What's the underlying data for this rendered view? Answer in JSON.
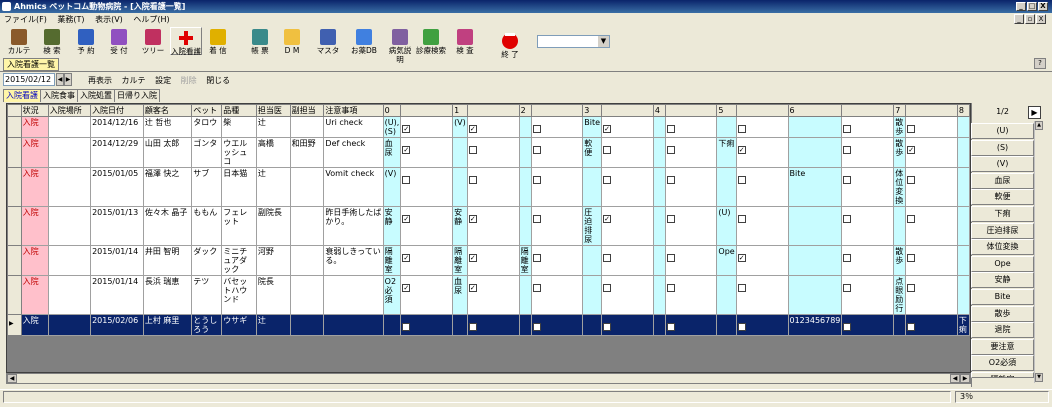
{
  "window": {
    "title": "Ahmics ペットコム動物病院 - [入院看護一覧]",
    "min": "_",
    "max": "□",
    "close": "X",
    "mdi_min": "_",
    "mdi_restore": "▫",
    "mdi_close": "X"
  },
  "menu": [
    "ファイル(F)",
    "業務(T)",
    "表示(V)",
    "ヘルプ(H)"
  ],
  "toolbar": [
    {
      "label": "カルテ",
      "icon": "paw-icon",
      "color": "#8a5a2b"
    },
    {
      "label": "検 索",
      "icon": "binoculars-icon",
      "color": "#556b2f"
    },
    {
      "label": "予 約",
      "icon": "calendar-icon",
      "color": "#3060c0"
    },
    {
      "label": "受 付",
      "icon": "reception-icon",
      "color": "#9050c0"
    },
    {
      "label": "ツリー",
      "icon": "tree-icon",
      "color": "#c03060"
    },
    {
      "label": "入院看護",
      "icon": "red-cross-icon",
      "color": "#e00000"
    },
    {
      "label": "着 信",
      "icon": "phone-icon",
      "color": "#e0b000"
    },
    {
      "label": "帳 票",
      "icon": "printer-icon",
      "color": "#3a8a8a"
    },
    {
      "label": "D M",
      "icon": "envelope-icon",
      "color": "#f0c040"
    },
    {
      "label": "マスタ",
      "icon": "master-icon",
      "color": "#4060b0"
    },
    {
      "label": "お薬DB",
      "icon": "pill-icon",
      "color": "#4080e0"
    },
    {
      "label": "病気説明",
      "icon": "document-icon",
      "color": "#8060a0"
    },
    {
      "label": "診療検索",
      "icon": "magnifier-icon",
      "color": "#40a040"
    },
    {
      "label": "検 査",
      "icon": "test-icon",
      "color": "#c04080"
    },
    {
      "label": "終 了",
      "icon": "stop-icon",
      "color": "#e00000"
    }
  ],
  "combo": {
    "value": "",
    "arrow": "▼"
  },
  "help": "?",
  "mdi_tab": "入院看護一覧",
  "date": "2015/02/12",
  "spin": {
    "prev": "◀",
    "next": "▶"
  },
  "actions": [
    {
      "label": "再表示",
      "disabled": false
    },
    {
      "label": "カルテ",
      "disabled": false
    },
    {
      "label": "設定",
      "disabled": false
    },
    {
      "label": "削除",
      "disabled": true
    },
    {
      "label": "閉じる",
      "disabled": false
    }
  ],
  "subtabs": [
    {
      "label": "入院看護",
      "active": true
    },
    {
      "label": "入院食事",
      "active": false
    },
    {
      "label": "入院処置",
      "active": false
    },
    {
      "label": "日帰り入院",
      "active": false
    }
  ],
  "grid": {
    "headers": [
      "状況",
      "入院場所",
      "入院日付",
      "顧客名",
      "ペット",
      "品種",
      "担当医",
      "副担当",
      "注意事項",
      "0",
      "",
      "1",
      "",
      "2",
      "",
      "3",
      "",
      "4",
      "",
      "5",
      "",
      "6",
      "",
      "7",
      "",
      "8"
    ],
    "rows": [
      {
        "status": "入院",
        "place": "",
        "date": "2014/12/16",
        "customer": "辻 哲也",
        "pet": "タロウ",
        "breed": "柴",
        "doctor": "辻",
        "sub": "",
        "note": "Uri check",
        "slots": [
          "(U),(S)",
          "(V)",
          "",
          "Bite",
          "",
          "",
          "",
          "散歩",
          ""
        ],
        "checks": [
          1,
          1,
          0,
          1,
          0,
          0,
          0,
          0
        ]
      },
      {
        "status": "入院",
        "place": "",
        "date": "2014/12/29",
        "customer": "山田 太郎",
        "pet": "ゴンタ",
        "breed": "ウエルッシュコ",
        "doctor": "高橋",
        "sub": "和田野",
        "note": "Def check",
        "slots": [
          "血尿",
          "",
          "",
          "軟便",
          "",
          "下痢",
          "",
          "散歩",
          ""
        ],
        "checks": [
          1,
          0,
          0,
          0,
          0,
          1,
          0,
          1
        ]
      },
      {
        "status": "入院",
        "place": "",
        "date": "2015/01/05",
        "customer": "福澤 快之",
        "pet": "サブ",
        "breed": "日本猫",
        "doctor": "辻",
        "sub": "",
        "note": "Vomit check",
        "slots": [
          "(V)",
          "",
          "",
          "",
          "",
          "",
          "Bite",
          "体位変換",
          ""
        ],
        "checks": [
          0,
          0,
          0,
          0,
          0,
          0,
          0,
          0
        ]
      },
      {
        "status": "入院",
        "place": "",
        "date": "2015/01/13",
        "customer": "佐々木 晶子",
        "pet": "ももん",
        "breed": "フェレット",
        "doctor": "副院長",
        "sub": "",
        "note": "昨日手術したばかり。",
        "slots": [
          "安静",
          "安静",
          "",
          "圧迫排尿",
          "",
          "(U)",
          "",
          "",
          ""
        ],
        "checks": [
          1,
          1,
          0,
          1,
          0,
          0,
          0,
          0
        ]
      },
      {
        "status": "入院",
        "place": "",
        "date": "2015/01/14",
        "customer": "井田 智明",
        "pet": "ダック",
        "breed": "ミニチュアダック",
        "doctor": "河野",
        "sub": "",
        "note": "衰弱しきっている。",
        "slots": [
          "隔離室",
          "隔離室",
          "隔離室",
          "",
          "",
          "Ope",
          "",
          "散歩",
          ""
        ],
        "checks": [
          1,
          1,
          0,
          0,
          0,
          1,
          0,
          0
        ]
      },
      {
        "status": "入院",
        "place": "",
        "date": "2015/01/14",
        "customer": "長浜 瑞恵",
        "pet": "テツ",
        "breed": "バセットハウンド",
        "doctor": "院長",
        "sub": "",
        "note": "",
        "slots": [
          "O2必須",
          "血尿",
          "",
          "",
          "",
          "",
          "",
          "点眼励行",
          ""
        ],
        "checks": [
          1,
          1,
          0,
          0,
          0,
          0,
          0,
          0
        ]
      },
      {
        "status": "入院",
        "place": "",
        "date": "2015/02/06",
        "customer": "上村 麻里",
        "pet": "とうしろう",
        "breed": "ウサギ",
        "doctor": "辻",
        "sub": "",
        "note": "",
        "slots": [
          "",
          "",
          "",
          "",
          "",
          "",
          "0123456789",
          "",
          "下痢"
        ],
        "checks": [
          0,
          0,
          0,
          0,
          0,
          0,
          0,
          0
        ],
        "selected": true
      }
    ]
  },
  "right_panel": {
    "page": "1/2",
    "next": "▶",
    "items": [
      "(U)",
      "(S)",
      "(V)",
      "血尿",
      "軟便",
      "下痢",
      "圧迫排尿",
      "体位変換",
      "Ope",
      "安静",
      "Bite",
      "散歩",
      "退院",
      "要注意",
      "O2必須",
      "隔離室"
    ]
  },
  "scroll": {
    "left": "◀",
    "right": "▶",
    "up": "▲",
    "down": "▼"
  },
  "status": {
    "zoom": "3％"
  }
}
